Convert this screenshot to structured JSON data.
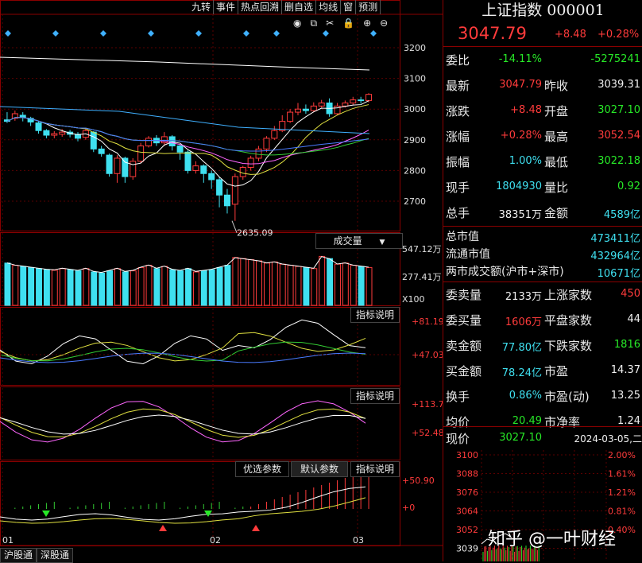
{
  "toolbar": {
    "buttons": [
      "九转",
      "事件",
      "热点回溯",
      "删自选",
      "均线",
      "窗",
      "预测"
    ],
    "icons": [
      "eye-icon",
      "copy-icon",
      "scissors-icon",
      "lock-icon",
      "plus-icon",
      "minus-icon"
    ]
  },
  "quote": {
    "title": "上证指数 000001",
    "price": "3047.79",
    "change": "+8.48",
    "change_pct": "+0.28%"
  },
  "stats": [
    {
      "label": "委比",
      "v1": "-14.11%",
      "v1c": "green",
      "label2": "",
      "v2": "-5275241",
      "v2c": "green"
    },
    {
      "label": "最新",
      "v1": "3047.79",
      "v1c": "red",
      "label2": "昨收",
      "v2": "3039.31",
      "v2c": "white"
    },
    {
      "label": "涨跌",
      "v1": "+8.48",
      "v1c": "red",
      "label2": "开盘",
      "v2": "3027.10",
      "v2c": "green"
    },
    {
      "label": "涨幅",
      "v1": "+0.28%",
      "v1c": "red",
      "label2": "最高",
      "v2": "3052.54",
      "v2c": "red"
    },
    {
      "label": "振幅",
      "v1": "1.00%",
      "v1c": "cyan",
      "label2": "最低",
      "v2": "3022.18",
      "v2c": "green"
    },
    {
      "label": "现手",
      "v1": "1804930",
      "v1c": "cyan",
      "label2": "量比",
      "v2": "0.92",
      "v2c": "green"
    },
    {
      "label": "总手",
      "v1": "38351万",
      "v1c": "white",
      "label2": "金额",
      "v2": "4589亿",
      "v2c": "cyan"
    }
  ],
  "market": [
    {
      "label": "总市值",
      "value": "473411亿"
    },
    {
      "label": "流通市值",
      "value": "432964亿"
    },
    {
      "label": "两市成交额(沪市+深市)",
      "value": "10671亿"
    }
  ],
  "orders": [
    {
      "label": "委卖量",
      "v1": "2133万",
      "v1c": "white",
      "label2": "上涨家数",
      "v2": "450",
      "v2c": "red"
    },
    {
      "label": "委买量",
      "v1": "1606万",
      "v1c": "red",
      "label2": "平盘家数",
      "v2": "44",
      "v2c": "white"
    },
    {
      "label": "卖金额",
      "v1": "77.80亿",
      "v1c": "cyan",
      "label2": "下跌家数",
      "v2": "1816",
      "v2c": "green"
    },
    {
      "label": "买金额",
      "v1": "78.24亿",
      "v1c": "cyan",
      "label2": "市盈",
      "v2": "14.37",
      "v2c": "white"
    },
    {
      "label": "换手",
      "v1": "0.86%",
      "v1c": "cyan",
      "label2": "市盈(动)",
      "v2": "13.25",
      "v2c": "white"
    },
    {
      "label": "均价",
      "v1": "20.49",
      "v1c": "green",
      "label2": "市净率",
      "v2": "1.24",
      "v2c": "white"
    }
  ],
  "intraday": {
    "label": "现价",
    "price": "3027.10",
    "date": "2024-03-05,二",
    "yticks": [
      "3100",
      "3088",
      "3076",
      "3064",
      "3052",
      "3039"
    ],
    "pcts": [
      "2.00%",
      "1.61%",
      "1.21%",
      "0.81%",
      "0.40%"
    ]
  },
  "main_chart": {
    "yticks": [
      "3200",
      "3100",
      "3000",
      "2900",
      "2800",
      "2700"
    ],
    "low_label": "2635.09",
    "vol_label": "成交量",
    "vol_ticks": [
      "547.12万",
      "277.41万",
      "X100"
    ],
    "ind1_label": "指标说明",
    "ind1_ticks": [
      "+81.19",
      "+47.03"
    ],
    "ind2_label": "指标说明",
    "ind2_ticks": [
      "+113.7",
      "+52.48"
    ],
    "tabs": [
      "优选参数",
      "默认参数",
      "指标说明"
    ],
    "ind3_ticks": [
      "+50.90",
      "+0"
    ],
    "xlabels": [
      "01",
      "02",
      "03"
    ]
  },
  "bottom_tabs": [
    "沪股通",
    "深股通"
  ],
  "watermark": "知乎 @一叶财经",
  "chart_data": {
    "type": "candlestick",
    "candles": [
      [
        2965,
        2960,
        2990,
        2955
      ],
      [
        2970,
        2985,
        2995,
        2962
      ],
      [
        2980,
        2972,
        2990,
        2960
      ],
      [
        2970,
        2958,
        2975,
        2945
      ],
      [
        2955,
        2930,
        2960,
        2920
      ],
      [
        2930,
        2915,
        2935,
        2905
      ],
      [
        2915,
        2920,
        2928,
        2905
      ],
      [
        2918,
        2925,
        2935,
        2910
      ],
      [
        2925,
        2918,
        2932,
        2908
      ],
      [
        2918,
        2905,
        2925,
        2895
      ],
      [
        2908,
        2930,
        2935,
        2900
      ],
      [
        2925,
        2870,
        2928,
        2860
      ],
      [
        2870,
        2855,
        2880,
        2845
      ],
      [
        2850,
        2790,
        2855,
        2780
      ],
      [
        2790,
        2840,
        2850,
        2760
      ],
      [
        2840,
        2780,
        2845,
        2760
      ],
      [
        2780,
        2830,
        2840,
        2770
      ],
      [
        2830,
        2880,
        2890,
        2825
      ],
      [
        2880,
        2905,
        2912,
        2875
      ],
      [
        2905,
        2890,
        2915,
        2880
      ],
      [
        2890,
        2910,
        2925,
        2880
      ],
      [
        2910,
        2880,
        2915,
        2865
      ],
      [
        2880,
        2860,
        2885,
        2835
      ],
      [
        2860,
        2800,
        2865,
        2790
      ],
      [
        2800,
        2815,
        2830,
        2790
      ],
      [
        2815,
        2790,
        2820,
        2760
      ],
      [
        2790,
        2770,
        2800,
        2740
      ],
      [
        2770,
        2720,
        2780,
        2680
      ],
      [
        2720,
        2685,
        2740,
        2660
      ],
      [
        2690,
        2780,
        2790,
        2636
      ],
      [
        2780,
        2810,
        2815,
        2770
      ],
      [
        2810,
        2840,
        2848,
        2800
      ],
      [
        2840,
        2870,
        2880,
        2830
      ],
      [
        2870,
        2905,
        2912,
        2860
      ],
      [
        2905,
        2930,
        2945,
        2900
      ],
      [
        2930,
        2960,
        2980,
        2925
      ],
      [
        2960,
        2990,
        3000,
        2955
      ],
      [
        2990,
        3000,
        3020,
        2980
      ],
      [
        3000,
        2995,
        3015,
        2985
      ],
      [
        2995,
        3010,
        3022,
        2990
      ],
      [
        3010,
        3020,
        3030,
        3005
      ],
      [
        3020,
        2985,
        3035,
        2975
      ],
      [
        2985,
        3010,
        3020,
        2980
      ],
      [
        3010,
        3020,
        3028,
        3005
      ],
      [
        3020,
        3030,
        3040,
        3012
      ],
      [
        3030,
        3028,
        3040,
        3018
      ],
      [
        3028,
        3048,
        3052,
        3022
      ]
    ],
    "volume": [
      380,
      360,
      350,
      340,
      330,
      320,
      315,
      330,
      320,
      310,
      330,
      300,
      290,
      310,
      330,
      300,
      310,
      340,
      360,
      330,
      350,
      320,
      310,
      330,
      300,
      310,
      320,
      340,
      360,
      430,
      420,
      410,
      400,
      380,
      390,
      370,
      360,
      350,
      340,
      330,
      440,
      420,
      370,
      380,
      360,
      350,
      340
    ]
  }
}
